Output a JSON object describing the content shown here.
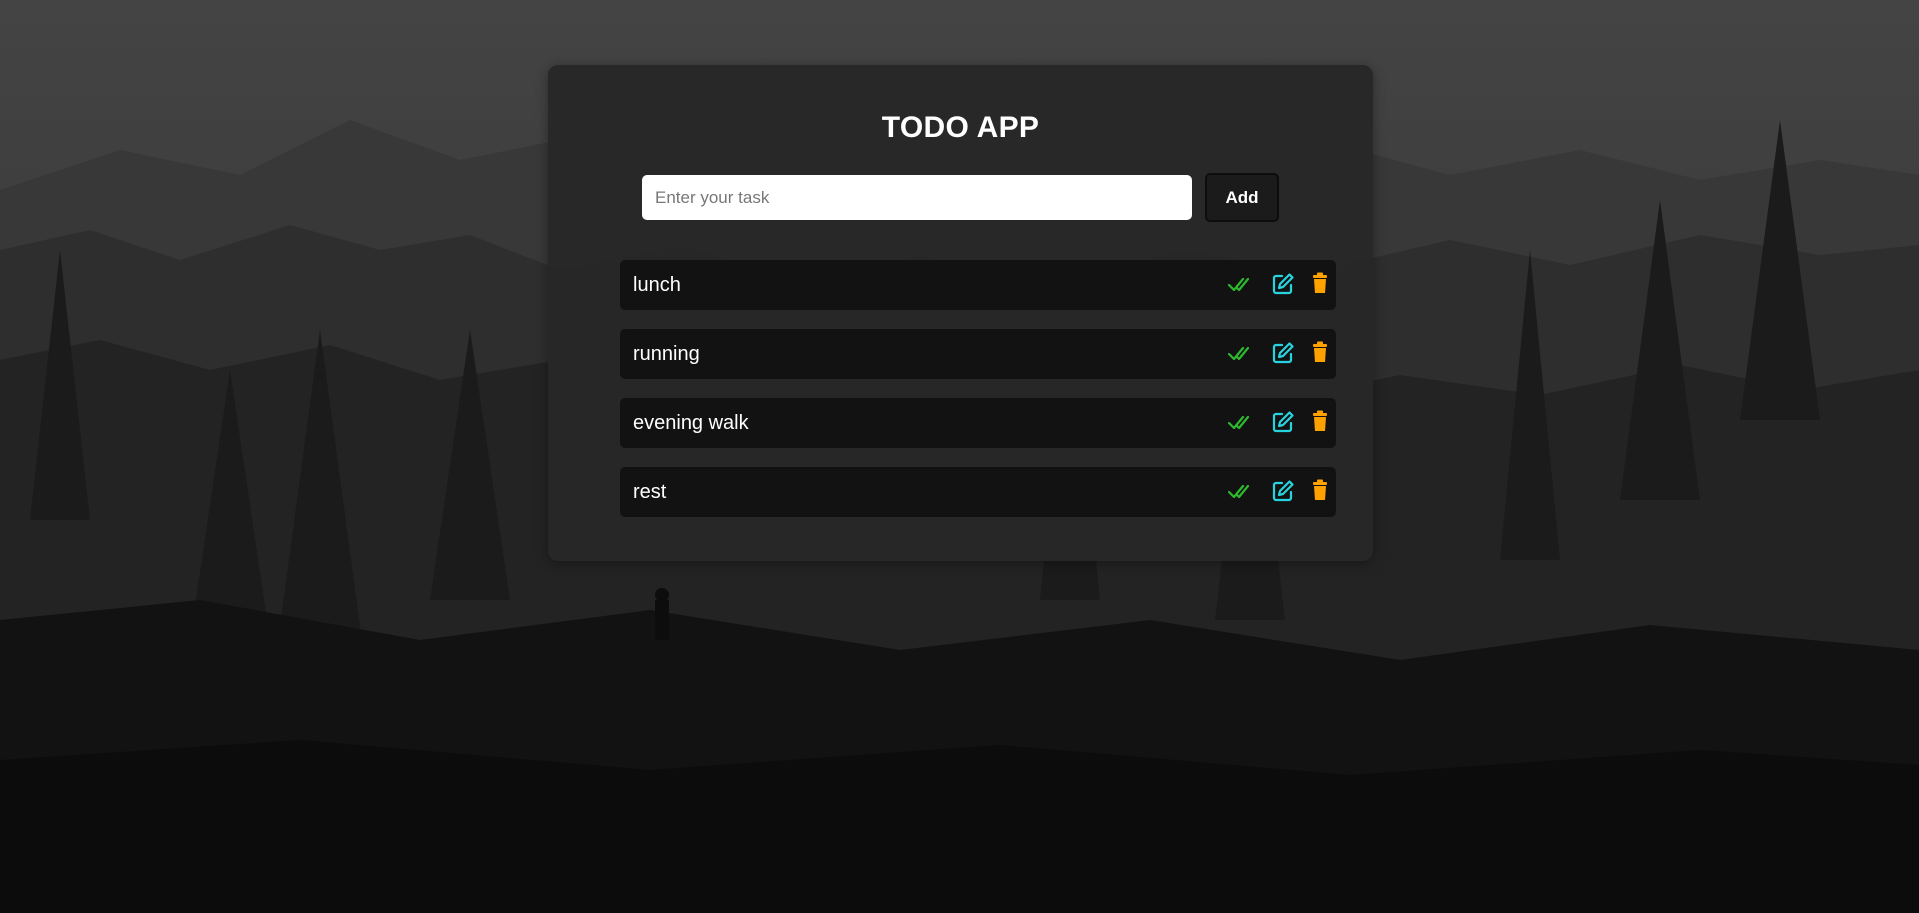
{
  "app": {
    "title": "TODO APP"
  },
  "form": {
    "placeholder": "Enter your task",
    "value": "",
    "add_label": "Add"
  },
  "tasks": [
    {
      "text": "lunch"
    },
    {
      "text": "running"
    },
    {
      "text": "evening walk"
    },
    {
      "text": "rest"
    }
  ],
  "icons": {
    "done": "double-check-icon",
    "edit": "edit-icon",
    "delete": "trash-icon"
  },
  "colors": {
    "done": "#2db82d",
    "edit": "#28d3e0",
    "delete": "#ffa200"
  }
}
